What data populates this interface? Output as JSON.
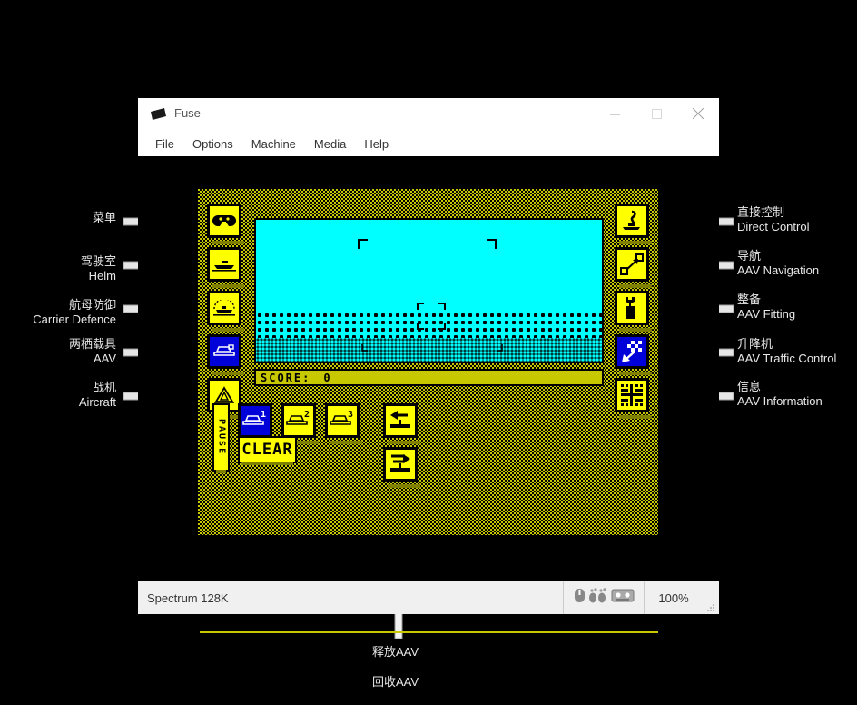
{
  "window": {
    "title": "Fuse",
    "icon": "cassette-icon",
    "controls": {
      "minimize": "–",
      "maximize": "□",
      "close": "✕"
    },
    "menu": [
      "File",
      "Options",
      "Machine",
      "Media",
      "Help"
    ]
  },
  "statusbar": {
    "machine": "Spectrum 128K",
    "zoom": "100%",
    "icons": [
      "mouse-icon",
      "joystick-icon",
      "tape-icon"
    ]
  },
  "game": {
    "score_label": "SCORE:",
    "score_value": "0",
    "pause_label": "PAUSE",
    "clear_label": "CLEAR",
    "aav_slots": [
      "1",
      "2",
      "3"
    ],
    "colors": {
      "panel_bg": "#c8c800",
      "button_yellow": "#ffff00",
      "button_blue": "#0000d8",
      "sky_cyan": "#00ffff",
      "ink_black": "#000000",
      "shadow_olive": "#808000"
    },
    "left_buttons": [
      {
        "name": "menu-button",
        "icon": "gamepad-icon",
        "state": "yellow"
      },
      {
        "name": "helm-button",
        "icon": "ship-icon",
        "state": "yellow"
      },
      {
        "name": "carrier-defence-button",
        "icon": "radar-ship-icon",
        "state": "yellow"
      },
      {
        "name": "aav-button",
        "icon": "hovercraft-icon",
        "state": "blue"
      },
      {
        "name": "aircraft-button",
        "icon": "aircraft-icon",
        "state": "yellow"
      }
    ],
    "right_buttons": [
      {
        "name": "direct-control-button",
        "icon": "joystick-hand-icon",
        "state": "yellow"
      },
      {
        "name": "aav-navigation-button",
        "icon": "waypoint-arrow-icon",
        "state": "yellow"
      },
      {
        "name": "aav-fitting-button",
        "icon": "wrench-icon",
        "state": "yellow"
      },
      {
        "name": "aav-traffic-control-button",
        "icon": "chequered-flag-icon",
        "state": "blue"
      },
      {
        "name": "aav-information-button",
        "icon": "info-grid-icon",
        "state": "yellow"
      }
    ],
    "release_button_icon": "arrow-left-deck-icon",
    "recover_button_icon": "arrow-right-deck-icon"
  },
  "annotations": {
    "left": [
      {
        "cn": "菜单",
        "en": ""
      },
      {
        "cn": "驾驶室",
        "en": "Helm"
      },
      {
        "cn": "航母防御",
        "en": "Carrier Defence"
      },
      {
        "cn": "两栖载具",
        "en": "AAV"
      },
      {
        "cn": "战机",
        "en": "Aircraft"
      }
    ],
    "right": [
      {
        "cn": "直接控制",
        "en": "Direct Control"
      },
      {
        "cn": "导航",
        "en": "AAV Navigation"
      },
      {
        "cn": "整备",
        "en": "AAV Fitting"
      },
      {
        "cn": "升降机",
        "en": "AAV Traffic Control"
      },
      {
        "cn": "信息",
        "en": "AAV Information"
      }
    ],
    "bottom": [
      {
        "cn": "释放AAV",
        "en": ""
      },
      {
        "cn": "回收AAV",
        "en": ""
      }
    ]
  }
}
